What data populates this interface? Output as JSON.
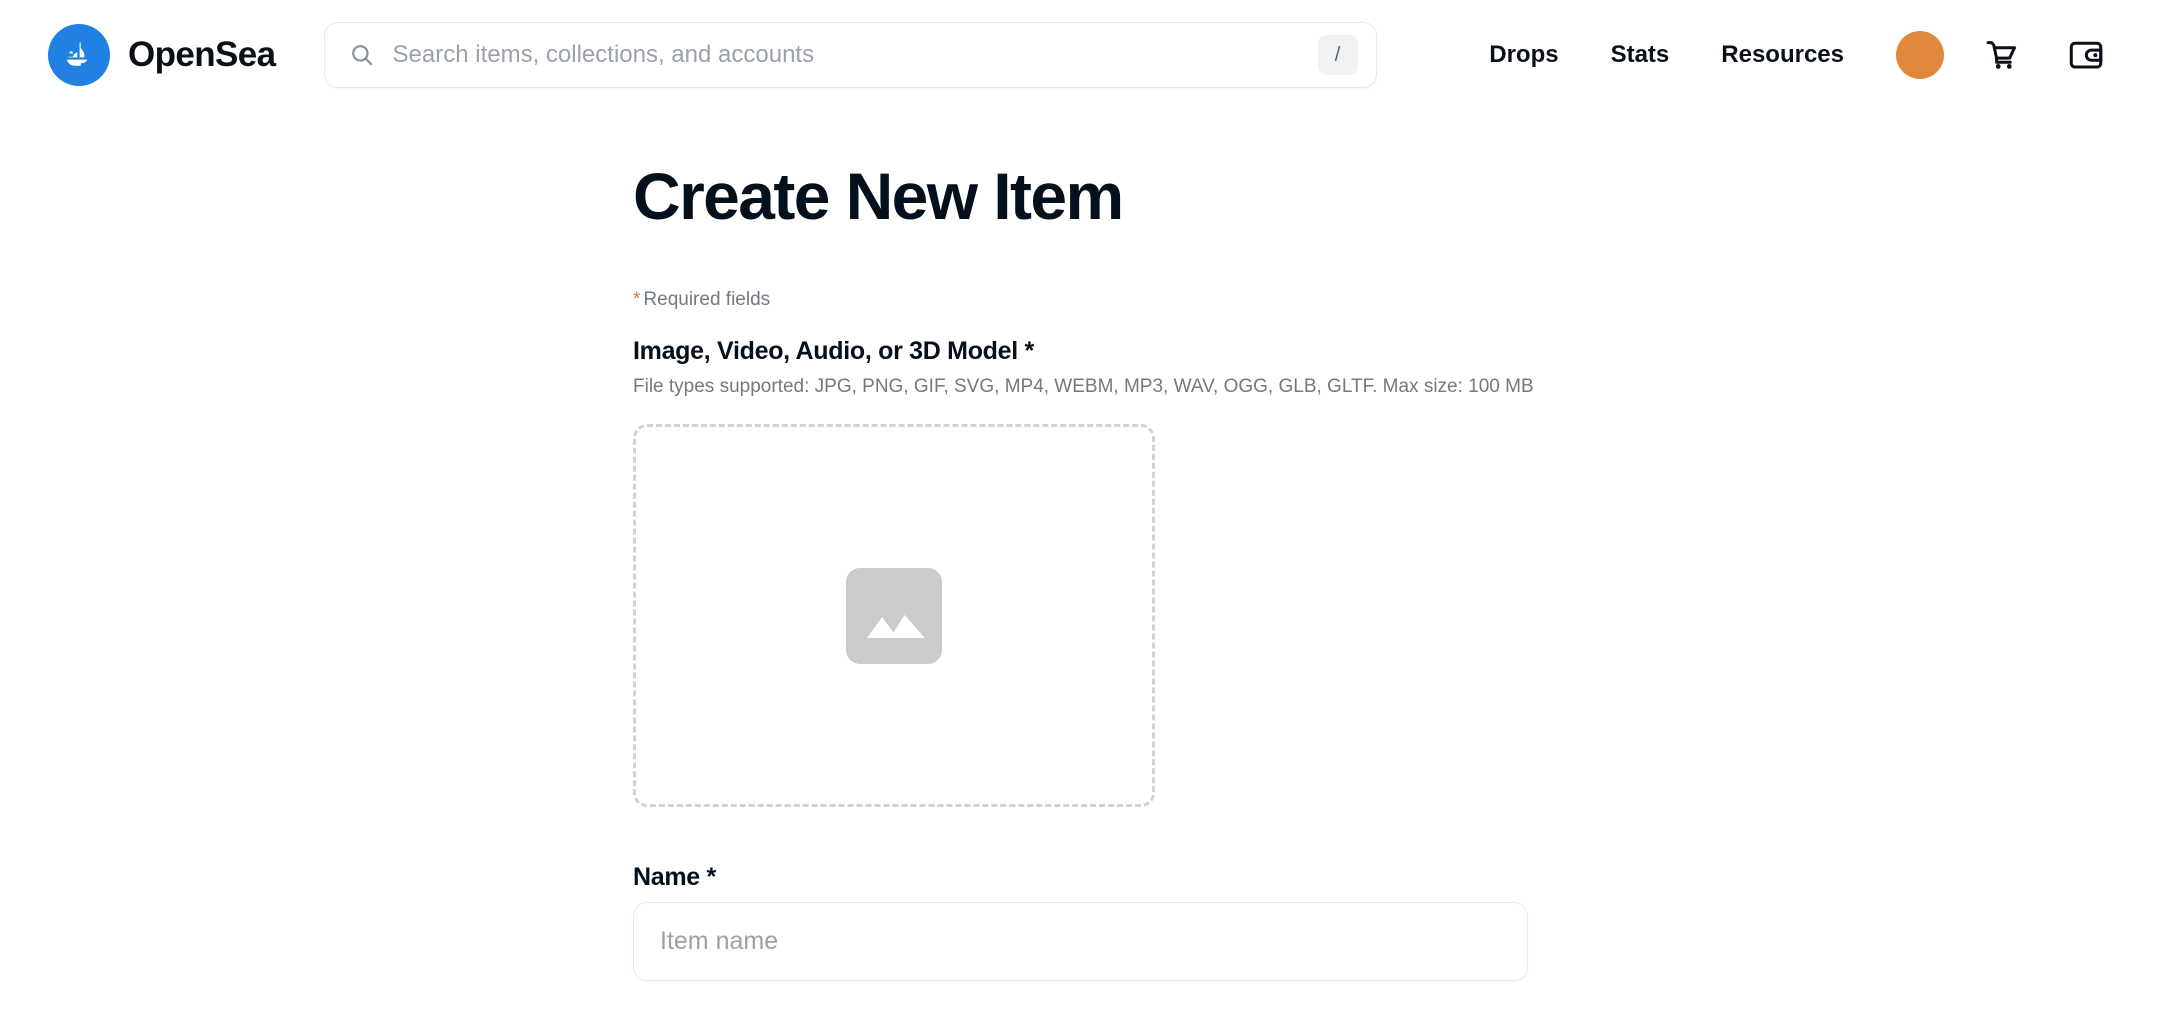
{
  "header": {
    "brand": {
      "name": "OpenSea",
      "logo_icon": "opensea-boat-logo-icon",
      "logo_color": "#2081E2"
    },
    "search": {
      "placeholder": "Search items, collections, and accounts",
      "value": "",
      "icon": "search-icon",
      "shortcut_badge": "/"
    },
    "nav_links": [
      {
        "label": "Drops"
      },
      {
        "label": "Stats"
      },
      {
        "label": "Resources"
      }
    ],
    "avatar": {
      "name": "profile-avatar",
      "color": "#E0883B"
    },
    "cart_icon": "shopping-cart-icon",
    "wallet_icon": "wallet-icon"
  },
  "main": {
    "title": "Create New Item",
    "required_note": {
      "star": "*",
      "text": "Required fields"
    },
    "media_field": {
      "label": "Image, Video, Audio, or 3D Model *",
      "hint": "File types supported: JPG, PNG, GIF, SVG, MP4, WEBM, MP3, WAV, OGG, GLB, GLTF. Max size: 100 MB",
      "dropzone_icon": "image-placeholder-icon"
    },
    "name_field": {
      "label": "Name *",
      "placeholder": "Item name",
      "value": ""
    }
  },
  "colors": {
    "accent_blue": "#2081E2",
    "text_dark": "#04111D",
    "text_muted": "#707A83",
    "required_star": "#C4813F",
    "avatar_orange": "#E0883B",
    "border": "#E6E8EC",
    "dashed_border": "#D3D3D3"
  }
}
